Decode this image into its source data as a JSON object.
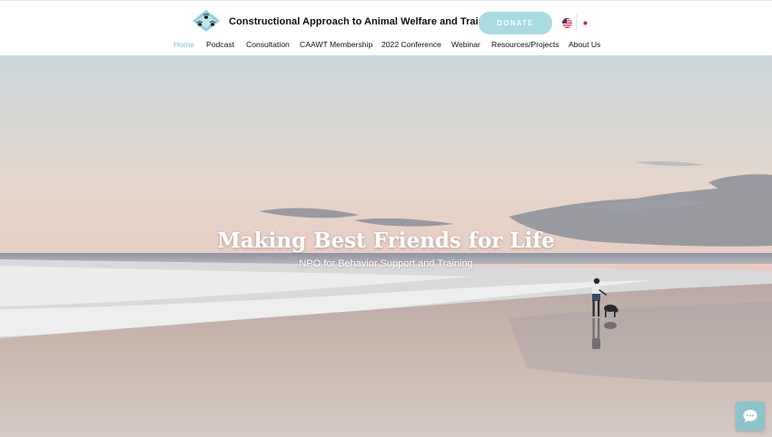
{
  "header": {
    "site_title": "Constructional Approach to Animal Welfare and Training",
    "donate_label": "DONATE",
    "logo_icon": "paw-diamond-logo-icon",
    "languages": [
      {
        "code": "en",
        "icon": "us-flag-icon"
      },
      {
        "code": "ja",
        "icon": "japan-flag-icon"
      }
    ]
  },
  "nav": {
    "items": [
      {
        "label": "Home",
        "active": true
      },
      {
        "label": "Podcast"
      },
      {
        "label": "Consultation"
      },
      {
        "label": "CAAWT Membership"
      },
      {
        "label": "2022 Conference"
      },
      {
        "label": "Webinar"
      },
      {
        "label": "Resources/Projects"
      },
      {
        "label": "About Us"
      }
    ]
  },
  "hero": {
    "title": "Making Best Friends for Life",
    "subtitle": "NPO for Behavior Support and Training"
  },
  "chat": {
    "icon": "chat-bubble-icon"
  },
  "colors": {
    "accent": "#7ec5d1",
    "donate_bg": "#a9dbe3",
    "chat_bg": "#8cc3cb"
  }
}
